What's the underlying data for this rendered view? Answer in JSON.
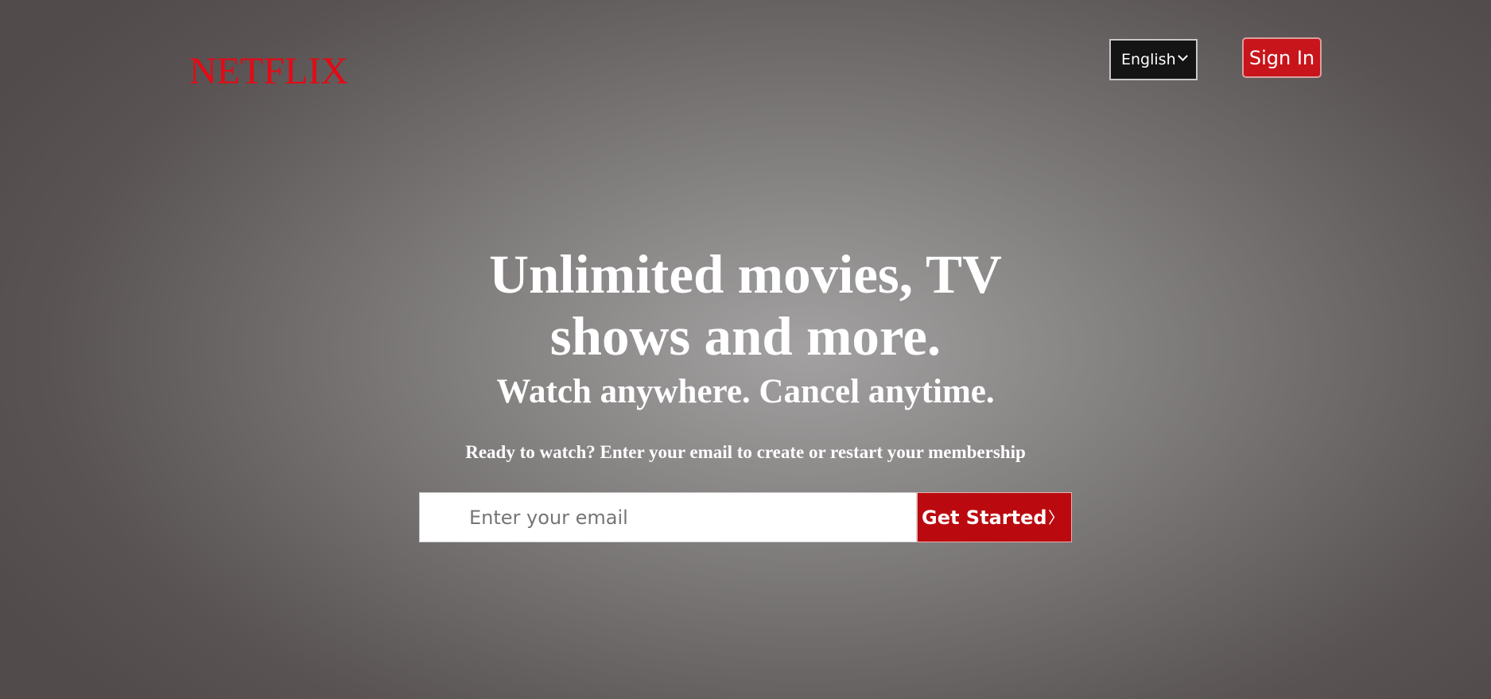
{
  "header": {
    "logo_text": "NETFLIX",
    "language_select": {
      "selected": "English"
    },
    "signin_label": "Sign In"
  },
  "hero": {
    "headline_line1": "Unlimited movies, TV",
    "headline_line2": "shows and more.",
    "subhead": "Watch anywhere. Cancel anytime.",
    "cta_text": "Ready to watch? Enter your email to create or restart your membership"
  },
  "email_form": {
    "placeholder": "Enter your email",
    "button_label": "Get Started",
    "button_arrow": "〉"
  },
  "colors": {
    "brand_red": "#e50914",
    "button_red": "#bb0a0f",
    "signin_red": "#c8151b"
  },
  "icons": {
    "language_chevron": "chevron-down-icon",
    "button_arrow": "chevron-right-icon"
  }
}
